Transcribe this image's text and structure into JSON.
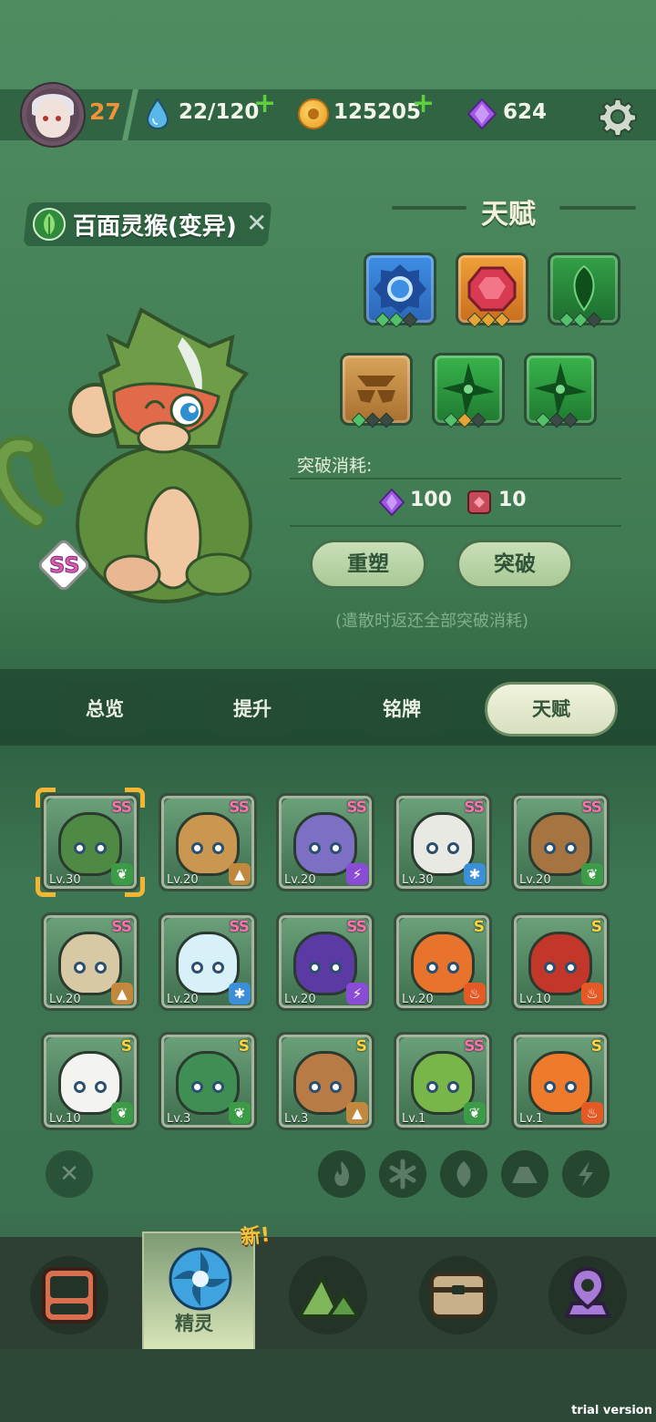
{
  "header": {
    "level": "27",
    "energy": "22/120",
    "coins": "125205",
    "gems": "624"
  },
  "pet": {
    "name": "百面灵猴(变异)",
    "rank": "SS"
  },
  "talent": {
    "title": "天赋",
    "tiles": [
      {
        "icon": "blue-gear-icon",
        "color": "#3a7fd6",
        "pips": [
          "on",
          "on",
          "off"
        ]
      },
      {
        "icon": "red-gem-icon",
        "color": "#d9862a",
        "pips": [
          "gold",
          "gold",
          "gold"
        ]
      },
      {
        "icon": "green-drop-icon",
        "color": "#2c8a3e",
        "pips": [
          "on",
          "on",
          "off"
        ]
      },
      {
        "icon": "golden-stack-icon",
        "color": "#c78d3a",
        "pips": [
          "on",
          "off",
          "off"
        ]
      },
      {
        "icon": "green-shuriken-icon",
        "color": "#2f9a3f",
        "pips": [
          "on",
          "gold",
          "off"
        ]
      },
      {
        "icon": "green-shuriken-icon",
        "color": "#2f9a3f",
        "pips": [
          "on",
          "off",
          "off"
        ]
      }
    ],
    "breakthrough_cost_label": "突破消耗:",
    "cost_gems": "100",
    "cost_books": "10",
    "reset_button": "重塑",
    "break_button": "突破",
    "note": "(遣散时返还全部突破消耗)"
  },
  "tabs": [
    "总览",
    "提升",
    "铭牌",
    "天赋"
  ],
  "active_tab": "天赋",
  "pets": [
    {
      "rank": "SS",
      "level": "Lv.30",
      "element": "leaf",
      "color": "#4f8a45",
      "selected": true
    },
    {
      "rank": "SS",
      "level": "Lv.20",
      "element": "earth",
      "color": "#c9974f"
    },
    {
      "rank": "SS",
      "level": "Lv.20",
      "element": "thunder",
      "color": "#7d6fc4"
    },
    {
      "rank": "SS",
      "level": "Lv.30",
      "element": "ice",
      "color": "#e9e9e4"
    },
    {
      "rank": "SS",
      "level": "Lv.20",
      "element": "leaf",
      "color": "#a57440"
    },
    {
      "rank": "SS",
      "level": "Lv.20",
      "element": "earth",
      "color": "#d6c9a4"
    },
    {
      "rank": "SS",
      "level": "Lv.20",
      "element": "ice",
      "color": "#d8f0f7"
    },
    {
      "rank": "SS",
      "level": "Lv.20",
      "element": "thunder",
      "color": "#5b3aa4"
    },
    {
      "rank": "S",
      "level": "Lv.20",
      "element": "fire",
      "color": "#e8732c"
    },
    {
      "rank": "S",
      "level": "Lv.10",
      "element": "fire",
      "color": "#c3372a"
    },
    {
      "rank": "S",
      "level": "Lv.10",
      "element": "leaf",
      "color": "#f3f3ef"
    },
    {
      "rank": "S",
      "level": "Lv.3",
      "element": "leaf",
      "color": "#3f8f55"
    },
    {
      "rank": "S",
      "level": "Lv.3",
      "element": "earth",
      "color": "#b97b45"
    },
    {
      "rank": "SS",
      "level": "Lv.1",
      "element": "leaf",
      "color": "#78b64a"
    },
    {
      "rank": "S",
      "level": "Lv.1",
      "element": "fire",
      "color": "#ee7a2c"
    }
  ],
  "filters": [
    "close-filter-icon",
    "fire-filter-icon",
    "ice-filter-icon",
    "leaf-filter-icon",
    "earth-filter-icon",
    "thunder-filter-icon"
  ],
  "nav": {
    "new_badge": "新!",
    "active_label": "精灵"
  },
  "watermark": "trial version",
  "colors": {
    "leaf": "#3c9b46",
    "fire": "#e55a24",
    "ice": "#3b8fd9",
    "earth": "#c2883d",
    "thunder": "#8a4bd6"
  }
}
